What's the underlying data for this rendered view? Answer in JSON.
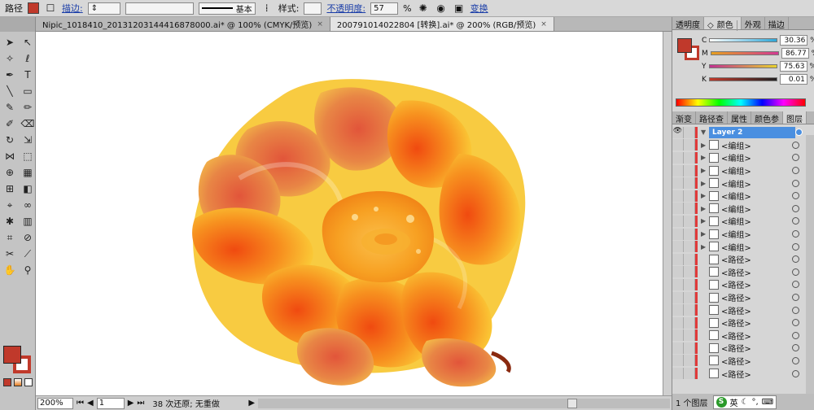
{
  "control_bar": {
    "object_type": "路径",
    "stroke_label": "描边:",
    "stroke_style": "基本",
    "style_label": "样式:",
    "opacity_label": "不透明度:",
    "opacity_value": "57",
    "opacity_unit": "%",
    "transform_label": "变换"
  },
  "tabs": [
    {
      "label": "Nipic_1018410_20131203144416878000.ai* @ 100% (CMYK/预览)",
      "close": "×"
    },
    {
      "label": "200791014022804 [转换].ai* @ 200% (RGB/预览)",
      "close": "×"
    }
  ],
  "color_panel": {
    "tabs": [
      "透明度",
      "颜色",
      "外观",
      "描边"
    ],
    "active_tab": "颜色",
    "channels": [
      {
        "name": "C",
        "value": "30.36",
        "unit": "%",
        "color": "#2fa7d8"
      },
      {
        "name": "M",
        "value": "86.77",
        "unit": "%",
        "color": "#d23a93"
      },
      {
        "name": "Y",
        "value": "75.63",
        "unit": "%",
        "color": "#e8d22e"
      },
      {
        "name": "K",
        "value": "0.01",
        "unit": "%",
        "color": "#333333"
      }
    ]
  },
  "layers_panel": {
    "tabs": [
      "渐变",
      "路径查",
      "属性",
      "颜色参",
      "图层"
    ],
    "active_tab": "图层",
    "layer_name": "Layer 2",
    "items": [
      {
        "name": "<编组>",
        "arrow": "▶"
      },
      {
        "name": "<编组>",
        "arrow": "▶"
      },
      {
        "name": "<编组>",
        "arrow": "▶"
      },
      {
        "name": "<编组>",
        "arrow": "▶"
      },
      {
        "name": "<编组>",
        "arrow": "▶"
      },
      {
        "name": "<编组>",
        "arrow": "▶"
      },
      {
        "name": "<编组>",
        "arrow": "▶"
      },
      {
        "name": "<编组>",
        "arrow": "▶"
      },
      {
        "name": "<编组>",
        "arrow": "▶"
      },
      {
        "name": "<路径>",
        "arrow": ""
      },
      {
        "name": "<路径>",
        "arrow": ""
      },
      {
        "name": "<路径>",
        "arrow": ""
      },
      {
        "name": "<路径>",
        "arrow": ""
      },
      {
        "name": "<路径>",
        "arrow": ""
      },
      {
        "name": "<路径>",
        "arrow": ""
      },
      {
        "name": "<路径>",
        "arrow": ""
      },
      {
        "name": "<路径>",
        "arrow": ""
      },
      {
        "name": "<路径>",
        "arrow": ""
      },
      {
        "name": "<路径>",
        "arrow": ""
      }
    ],
    "footer_label": "1 个图层"
  },
  "status_bar": {
    "zoom": "200%",
    "page": "1",
    "status_text": "38 次还原; 无重做"
  },
  "ime": {
    "logo": "S",
    "lang": "英"
  },
  "colors": {
    "fill": "#c0392b",
    "stroke": "#c0392b"
  }
}
